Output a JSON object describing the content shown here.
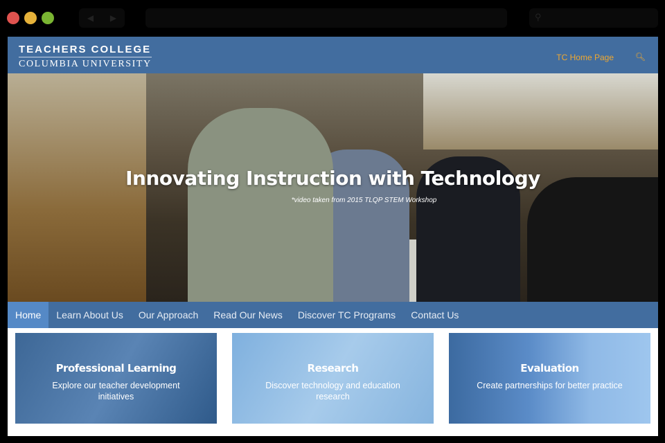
{
  "browser": {
    "window_controls": [
      "close",
      "minimize",
      "maximize"
    ],
    "colors": {
      "close": "#e0534f",
      "minimize": "#e6b23a",
      "maximize": "#7ab532"
    }
  },
  "header": {
    "logo_line1": "TEACHERS COLLEGE",
    "logo_line2": "COLUMBIA UNIVERSITY",
    "home_link": "TC Home Page",
    "search_icon": "search-icon"
  },
  "hero": {
    "title": "Innovating Instruction with Technology",
    "caption": "*video taken from 2015 TLQP STEM Workshop"
  },
  "nav": {
    "items": [
      "Home",
      "Learn About Us",
      "Our Approach",
      "Read Our News",
      "Discover TC Programs",
      "Contact Us"
    ],
    "active": "Home"
  },
  "cards": [
    {
      "title": "Professional Learning",
      "text": "Explore our teacher development initiatives"
    },
    {
      "title": "Research",
      "text": "Discover technology and education research"
    },
    {
      "title": "Evaluation",
      "text": "Create partnerships for better practice"
    }
  ],
  "colors": {
    "brand": "#426d9f",
    "accent": "#f0a830",
    "active_nav": "#5589c6"
  }
}
